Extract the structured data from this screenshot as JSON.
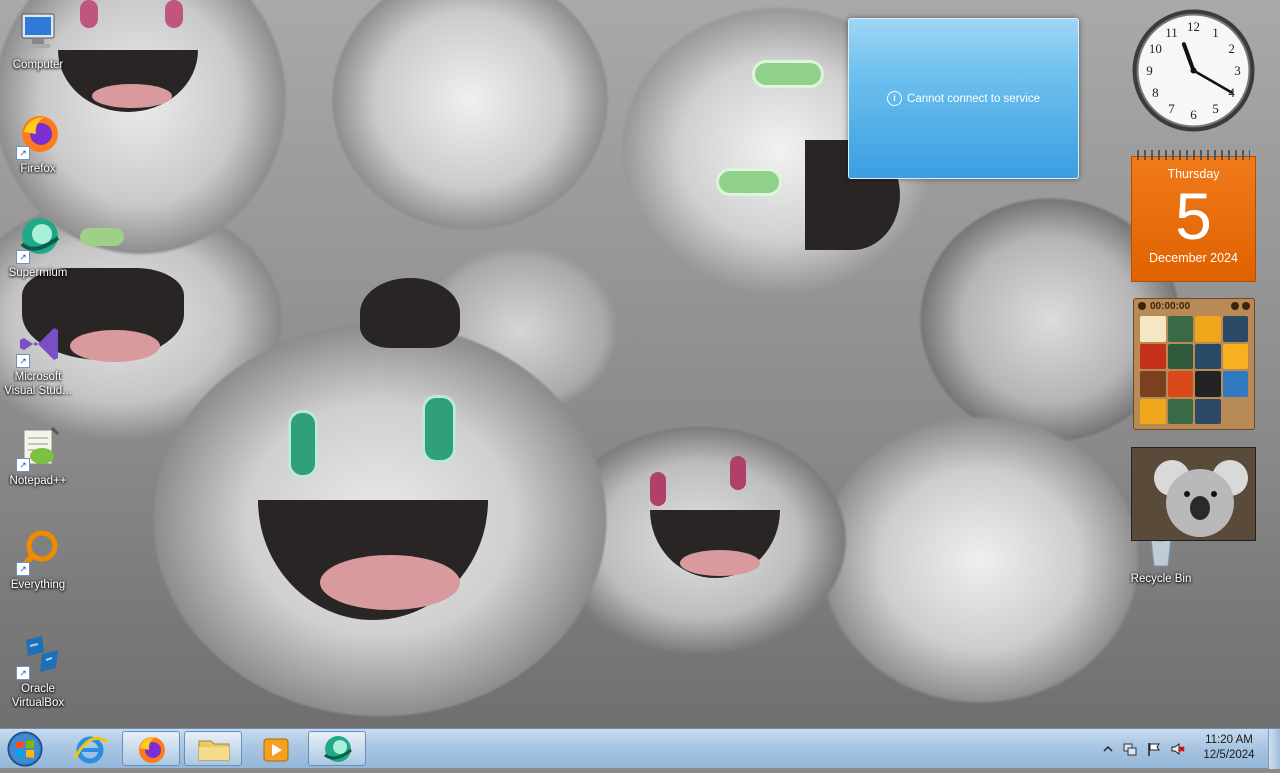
{
  "desktop": {
    "icons": [
      {
        "label": "Computer"
      },
      {
        "label": "Firefox"
      },
      {
        "label": "Supermium"
      },
      {
        "label": "Microsoft Visual Stud..."
      },
      {
        "label": "Notepad++"
      },
      {
        "label": "Everything"
      },
      {
        "label": "Oracle VirtualBox"
      },
      {
        "label": "Recycle Bin"
      }
    ],
    "wallpaper": "smiling-white-creatures-wallpaper"
  },
  "notification": {
    "icon": "info-icon",
    "message": "Cannot connect to service"
  },
  "gadgets": {
    "clock": {
      "hour": 11,
      "minute": 20,
      "numerals": [
        "12",
        "1",
        "2",
        "3",
        "4",
        "5",
        "6",
        "7",
        "8",
        "9",
        "10",
        "11"
      ]
    },
    "calendar": {
      "weekday": "Thursday",
      "day": "5",
      "month_year": "December 2024"
    },
    "puzzle": {
      "timer": "00:00:00"
    },
    "slideshow": {
      "subject": "koala-photo"
    }
  },
  "taskbar": {
    "start_icon": "windows-start-orb",
    "items": [
      {
        "name": "internet-explorer-icon",
        "state": "pinned"
      },
      {
        "name": "firefox-icon",
        "state": "running"
      },
      {
        "name": "file-explorer-icon",
        "state": "running"
      },
      {
        "name": "media-player-icon",
        "state": "pinned"
      },
      {
        "name": "supermium-icon",
        "state": "running"
      }
    ],
    "tray": {
      "icons": [
        "show-hidden-icons-chevron",
        "network-icon",
        "action-center-flag-icon",
        "volume-muted-icon"
      ],
      "time": "11:20 AM",
      "date": "12/5/2024"
    }
  },
  "colors": {
    "popup_blue": "#3a9ee0",
    "calendar_orange": "#e06200",
    "taskbar": "#a9c6e2"
  }
}
